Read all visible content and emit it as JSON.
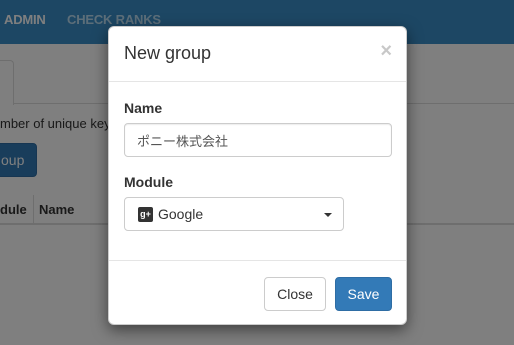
{
  "navbar": {
    "admin_label": "ADMIN",
    "check_ranks_label": "CHECK RANKS"
  },
  "page": {
    "description_partial": "mber of unique key",
    "group_button_partial": "oup"
  },
  "table": {
    "columns": [
      "dule",
      "Name"
    ]
  },
  "modal": {
    "title": "New group",
    "close_glyph": "×",
    "name_label": "Name",
    "name_value": "ポニー株式会社",
    "module_label": "Module",
    "module_icon": "google-plus-icon",
    "module_icon_glyph": "g+",
    "module_value": "Google",
    "close_button": "Close",
    "save_button": "Save"
  },
  "colors": {
    "navbar": "#3a8fc9",
    "primary": "#337ab7",
    "backdrop": "rgba(0,0,0,0.5)"
  }
}
